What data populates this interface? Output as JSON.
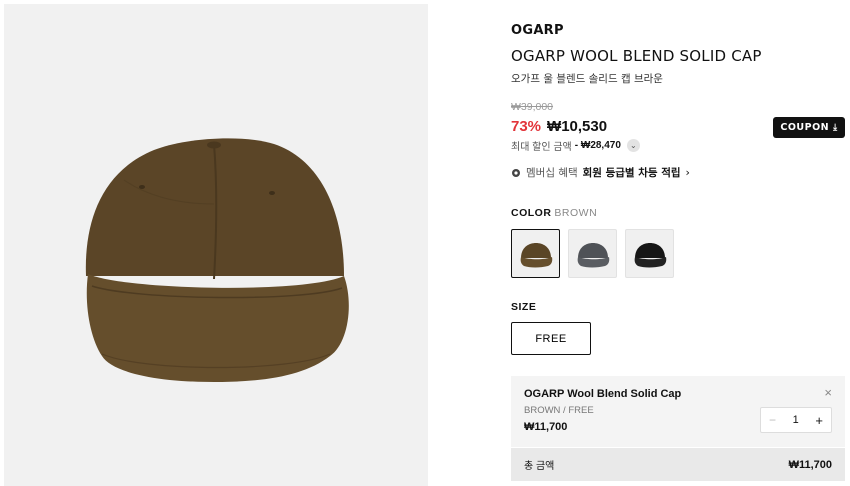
{
  "product": {
    "brand": "OGARP",
    "title": "OGARP WOOL BLEND SOLID CAP",
    "subtitle": "오가프 울 블렌드 솔리드 캡 브라운",
    "original_price": "₩39,000",
    "discount": "73%",
    "price": "₩10,530",
    "coupon_label": "COUPON",
    "max_discount_label": "최대 할인 금액",
    "max_discount_value": "- ₩28,470",
    "membership_label": "멤버십 혜택",
    "membership_value": "회원 등급별 차등 적립"
  },
  "color": {
    "label": "COLOR",
    "selected": "BROWN",
    "options": [
      {
        "name": "brown",
        "hex": "#5a4526"
      },
      {
        "name": "gray",
        "hex": "#4f5257"
      },
      {
        "name": "black",
        "hex": "#161616"
      }
    ]
  },
  "size": {
    "label": "SIZE",
    "option": "FREE"
  },
  "cart_item": {
    "name": "OGARP Wool Blend Solid Cap",
    "option": "BROWN / FREE",
    "price": "₩11,700",
    "quantity": "1",
    "close_icon": "×",
    "minus": "−",
    "plus": "+"
  },
  "total": {
    "label": "총 금액",
    "amount": "₩11,700"
  },
  "colors": {
    "discount_red": "#e2343a",
    "photo_bg": "#f1f1f1"
  }
}
